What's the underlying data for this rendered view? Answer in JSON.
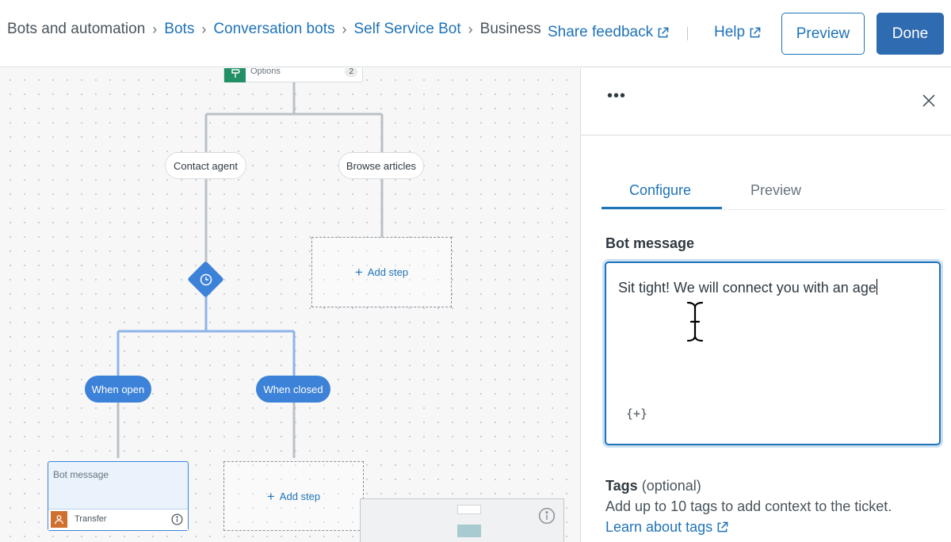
{
  "breadcrumbs": [
    {
      "label": "Bots and automation",
      "link": false
    },
    {
      "label": "Bots",
      "link": true
    },
    {
      "label": "Conversation bots",
      "link": true
    },
    {
      "label": "Self Service Bot",
      "link": true
    },
    {
      "label": "Business",
      "link": false
    }
  ],
  "header": {
    "share_feedback": "Share feedback",
    "help": "Help",
    "preview_button": "Preview",
    "done_button": "Done"
  },
  "canvas": {
    "options_node": {
      "label": "Options",
      "count": "2"
    },
    "branches": {
      "contact_agent": "Contact agent",
      "browse_articles": "Browse articles",
      "when_open": "When open",
      "when_closed": "When closed"
    },
    "add_step": "Add step",
    "bot_message_card": {
      "title": "Bot message",
      "footer": "Transfer"
    }
  },
  "panel": {
    "tabs": [
      {
        "label": "Configure",
        "active": true
      },
      {
        "label": "Preview",
        "active": false
      }
    ],
    "bot_message_label": "Bot message",
    "bot_message_value": "Sit tight! We will connect you with an age",
    "placeholder_button": "{+}",
    "tags_label": "Tags",
    "tags_optional": "(optional)",
    "tags_help": "Add up to 10 tags to add context to the ticket.",
    "tags_link": "Learn about tags"
  },
  "colors": {
    "accent": "#1f73b7",
    "done_button": "#2f6bb0",
    "node_blue": "#3d82d9",
    "options_icon": "#228f67",
    "transfer_icon": "#d0702e"
  },
  "icons": [
    "external-link-icon",
    "close-icon",
    "more-options-icon",
    "clock-icon",
    "options-icon",
    "person-icon",
    "info-icon",
    "text-cursor-icon"
  ]
}
